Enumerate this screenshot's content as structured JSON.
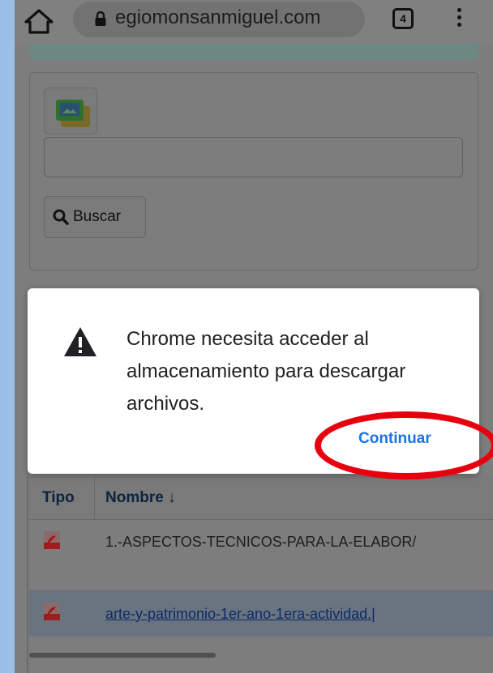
{
  "browser": {
    "url": "egiomonsanmiguel.com",
    "tab_count": "4"
  },
  "page": {
    "search_button_label": "Buscar",
    "search_input_value": "",
    "table": {
      "columns": [
        "Tipo",
        "Nombre ↓"
      ],
      "rows": [
        {
          "type_icon": "pdf-icon",
          "name": "1.-ASPECTOS-TECNICOS-PARA-LA-ELABOR/"
        },
        {
          "type_icon": "pdf-icon",
          "name": "arte-y-patrimonio-1er-ano-1era-actividad.|"
        }
      ]
    }
  },
  "dialog": {
    "message": "Chrome necesita acceder al almacenamiento para descargar archivos.",
    "continue_label": "Continuar"
  },
  "colors": {
    "dim_overlay": "#7d7d7d",
    "accent_link": "#1a73e8",
    "annotation_red": "#e8000e"
  }
}
